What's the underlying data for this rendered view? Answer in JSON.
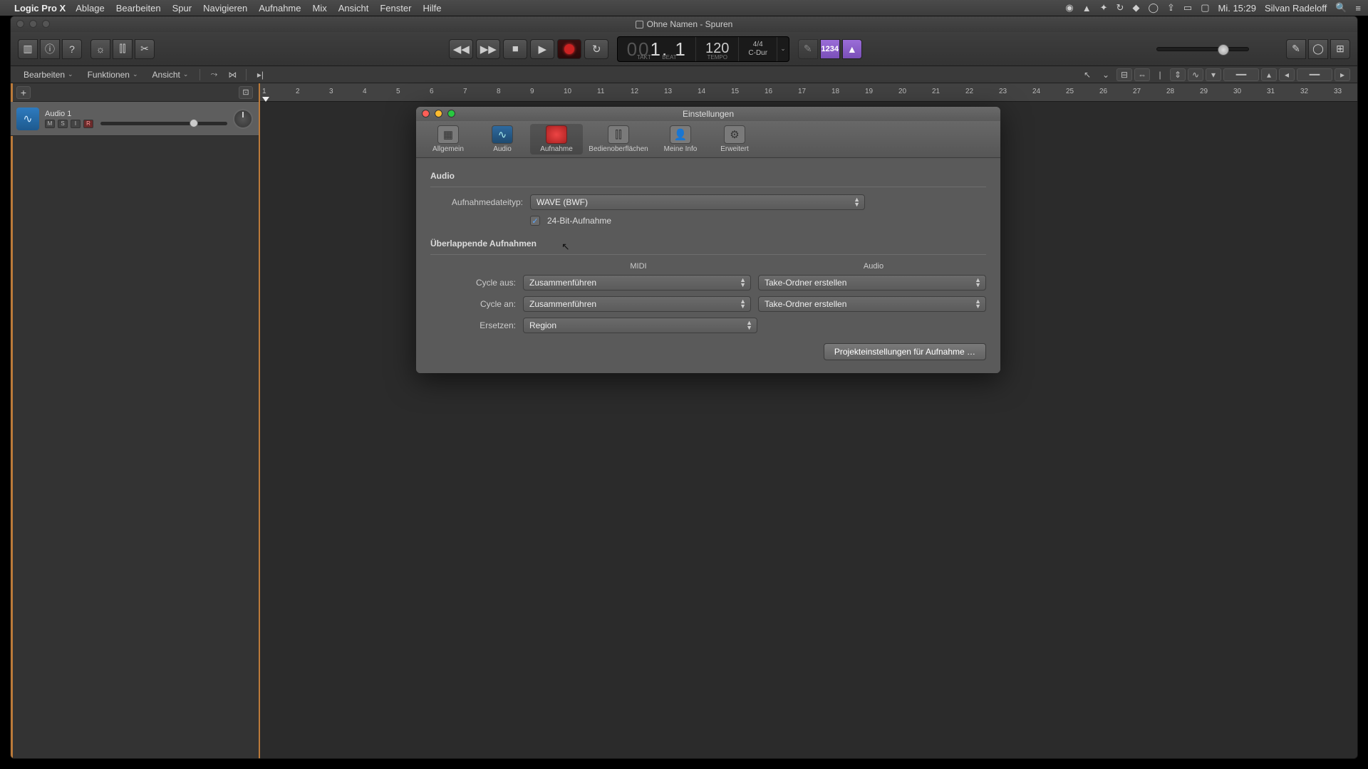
{
  "menubar": {
    "app": "Logic Pro X",
    "items": [
      "Ablage",
      "Bearbeiten",
      "Spur",
      "Navigieren",
      "Aufnahme",
      "Mix",
      "Ansicht",
      "Fenster",
      "Hilfe"
    ],
    "clock": "Mi. 15:29",
    "user": "Silvan Radeloff"
  },
  "window": {
    "title": "Ohne Namen - Spuren"
  },
  "lcd": {
    "bars_dim": "00",
    "bars": "1. 1",
    "bars_label": "TAKT",
    "beat_label": "BEAT",
    "tempo": "120",
    "tempo_label": "TEMPO",
    "sig": "4/4",
    "key": "C-Dur"
  },
  "countin": "1234",
  "subbar": {
    "edit": "Bearbeiten",
    "functions": "Funktionen",
    "view": "Ansicht"
  },
  "track": {
    "name": "Audio 1"
  },
  "ruler_ticks": [
    "1",
    "2",
    "3",
    "4",
    "5",
    "6",
    "7",
    "8",
    "9",
    "10",
    "11",
    "12",
    "13",
    "14",
    "15",
    "16",
    "17",
    "18",
    "19",
    "20",
    "21",
    "22",
    "23",
    "24",
    "25",
    "26",
    "27",
    "28",
    "29",
    "30",
    "31",
    "32",
    "33"
  ],
  "prefs": {
    "title": "Einstellungen",
    "tabs": {
      "general": "Allgemein",
      "audio": "Audio",
      "recording": "Aufnahme",
      "surfaces": "Bedienoberflächen",
      "myinfo": "Meine Info",
      "advanced": "Erweitert"
    },
    "section_audio": "Audio",
    "file_type_label": "Aufnahmedateityp:",
    "file_type_value": "WAVE (BWF)",
    "bit24_label": "24-Bit-Aufnahme",
    "section_overlap": "Überlappende Aufnahmen",
    "col_midi": "MIDI",
    "col_audio": "Audio",
    "cycle_off_label": "Cycle aus:",
    "cycle_on_label": "Cycle an:",
    "replace_label": "Ersetzen:",
    "midi_cycle_off": "Zusammenführen",
    "midi_cycle_on": "Zusammenführen",
    "midi_replace": "Region",
    "audio_cycle_off": "Take-Ordner erstellen",
    "audio_cycle_on": "Take-Ordner erstellen",
    "project_settings_btn": "Projekteinstellungen für Aufnahme …"
  }
}
